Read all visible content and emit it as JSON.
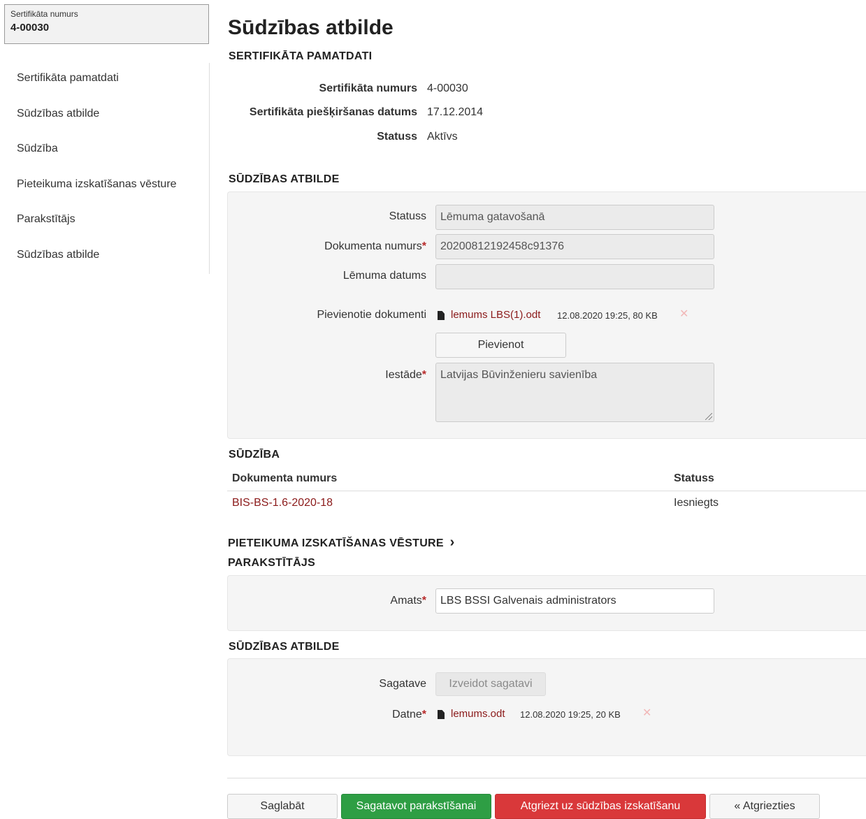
{
  "sidebar": {
    "cert_box": {
      "label": "Sertifikāta numurs",
      "value": "4-00030"
    },
    "items": [
      {
        "label": "Sertifikāta pamatdati"
      },
      {
        "label": "Sūdzības atbilde"
      },
      {
        "label": "Sūdzība"
      },
      {
        "label": "Pieteikuma izskatīšanas vēsture"
      },
      {
        "label": "Parakstītājs"
      },
      {
        "label": "Sūdzības atbilde"
      }
    ]
  },
  "main": {
    "title": "Sūdzības atbilde",
    "basic": {
      "heading": "SERTIFIKĀTA PAMATDATI",
      "rows": [
        {
          "label": "Sertifikāta numurs",
          "value": "4-00030"
        },
        {
          "label": "Sertifikāta piešķiršanas datums",
          "value": "17.12.2014"
        },
        {
          "label": "Statuss",
          "value": "Aktīvs"
        }
      ]
    },
    "response": {
      "heading": "SŪDZĪBAS ATBILDE",
      "status_label": "Statuss",
      "status_value": "Lēmuma gatavošanā",
      "docnum_label": "Dokumenta numurs",
      "docnum_value": "20200812192458c91376",
      "decision_date_label": "Lēmuma datums",
      "decision_date_value": "",
      "attached_label": "Pievienotie dokumenti",
      "attached_file": {
        "name": "lemums LBS(1).odt",
        "meta": "12.08.2020 19:25, 80 KB"
      },
      "add_button": "Pievienot",
      "institution_label": "Iestāde",
      "institution_value": "Latvijas Būvinženieru savienība",
      "required_mark": "*"
    },
    "complaint": {
      "heading": "SŪDZĪBA",
      "columns": [
        "Dokumenta numurs",
        "Statuss"
      ],
      "rows": [
        {
          "doc": "BIS-BS-1.6-2020-18",
          "status": "Iesniegts"
        }
      ]
    },
    "history": {
      "heading": "PIETEIKUMA IZSKATĪŠANAS VĒSTURE",
      "chevron": "›"
    },
    "signer": {
      "heading": "PARAKSTĪTĀJS",
      "position_label": "Amats",
      "position_value": "LBS BSSI Galvenais administrators"
    },
    "response2": {
      "heading": "SŪDZĪBAS ATBILDE",
      "template_label": "Sagatave",
      "template_button": "Izveidot sagatavi",
      "file_label": "Datne",
      "file": {
        "name": "lemums.odt",
        "meta": "12.08.2020 19:25, 20 KB"
      }
    },
    "actions": {
      "save": "Saglabāt",
      "prepare_sign": "Sagatavot parakstīšanai",
      "return_review": "Atgriezt uz sūdzības izskatīšanu",
      "back": "« Atgriezties"
    }
  },
  "colors": {
    "link": "#8b1a1a",
    "required": "#b72a2a",
    "primary_green": "#2e9e44",
    "danger_red": "#d9383a"
  },
  "icons": [
    "document-icon",
    "remove-x-icon",
    "chevron-right-icon",
    "resize-grip-icon"
  ]
}
